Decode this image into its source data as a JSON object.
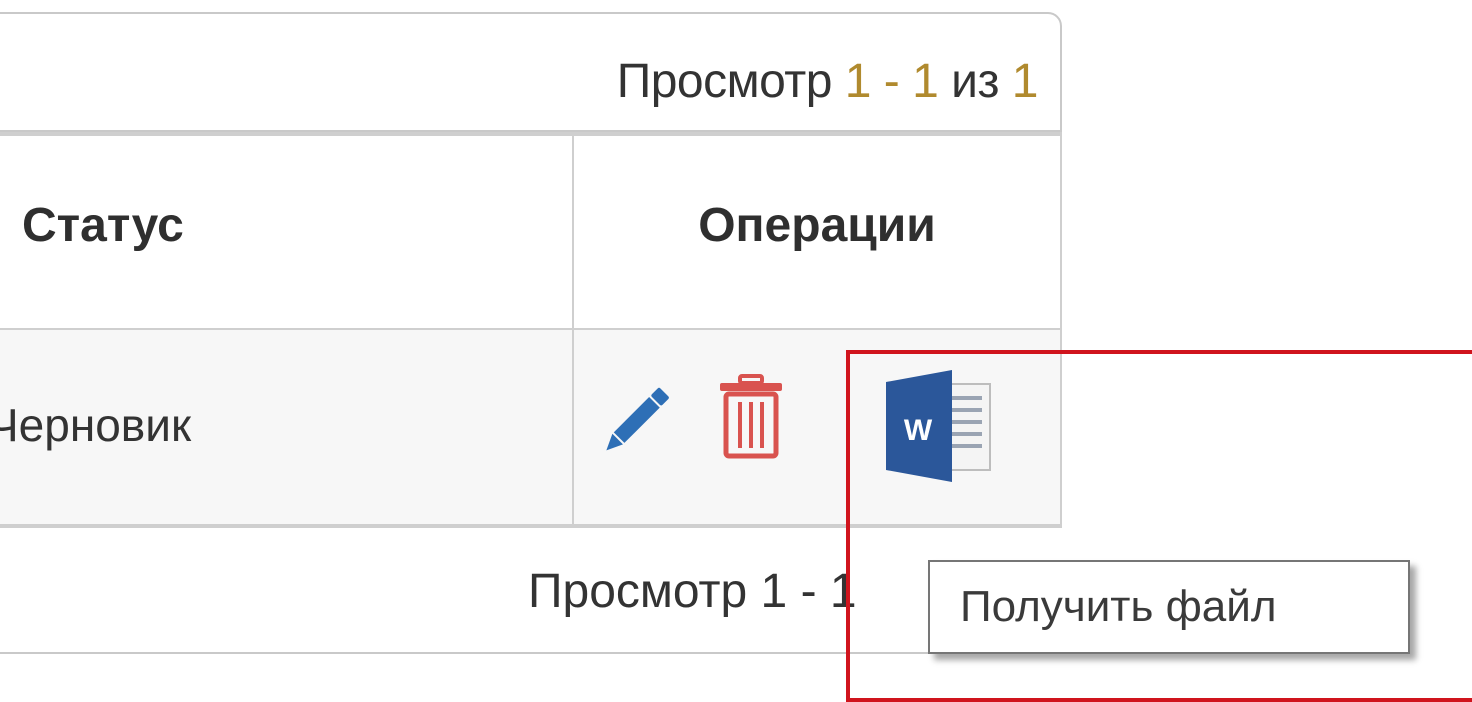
{
  "pager": {
    "top_prefix": "Просмотр ",
    "top_range": "1 - 1",
    "top_of": " из ",
    "top_total": "1",
    "bottom_text": "Просмотр 1 - 1"
  },
  "table": {
    "headers": [
      "Статус",
      "Операции"
    ],
    "rows": [
      {
        "status": "Черновик"
      }
    ]
  },
  "operations": {
    "icons": [
      "edit-pencil-icon",
      "delete-trash-icon",
      "word-document-icon"
    ]
  },
  "tooltip": {
    "text": "Получить файл"
  },
  "colors": {
    "highlight": "#d0141d",
    "edit_icon": "#2e6fb6",
    "delete_icon": "#d9534f",
    "word_icon": "#2b579a"
  }
}
